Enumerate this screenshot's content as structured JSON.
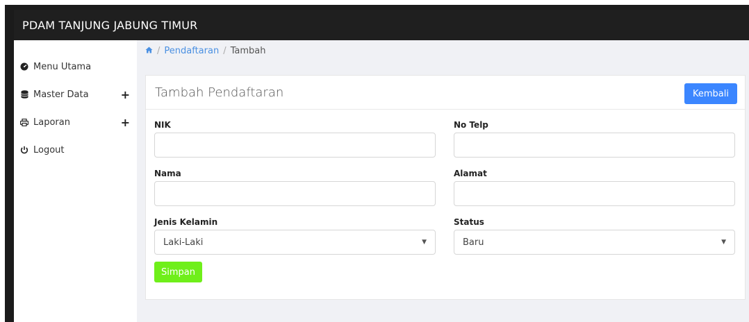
{
  "app": {
    "title": "PDAM TANJUNG JABUNG TIMUR"
  },
  "sidebar": {
    "items": [
      {
        "label": "Menu Utama",
        "icon": "dashboard-icon"
      },
      {
        "label": "Master Data",
        "icon": "database-icon",
        "expand": "+"
      },
      {
        "label": "Laporan",
        "icon": "print-icon",
        "expand": "+"
      },
      {
        "label": "Logout",
        "icon": "power-icon"
      }
    ]
  },
  "breadcrumb": {
    "home_icon": "home-icon",
    "items": [
      "Pendaftaran",
      "Tambah"
    ],
    "separator": "/"
  },
  "form": {
    "title": "Tambah Pendaftaran",
    "back_label": "Kembali",
    "save_label": "Simpan",
    "fields": {
      "nik": {
        "label": "NIK",
        "value": ""
      },
      "no_telp": {
        "label": "No Telp",
        "value": ""
      },
      "nama": {
        "label": "Nama",
        "value": ""
      },
      "alamat": {
        "label": "Alamat",
        "value": ""
      },
      "jenis_kelamin": {
        "label": "Jenis Kelamin",
        "value": "Laki-Laki"
      },
      "status": {
        "label": "Status",
        "value": "Baru"
      }
    }
  },
  "colors": {
    "primary": "#3b86ff",
    "success": "#6fef1a",
    "topbar": "#1f1f1f",
    "link": "#4a90e2"
  }
}
